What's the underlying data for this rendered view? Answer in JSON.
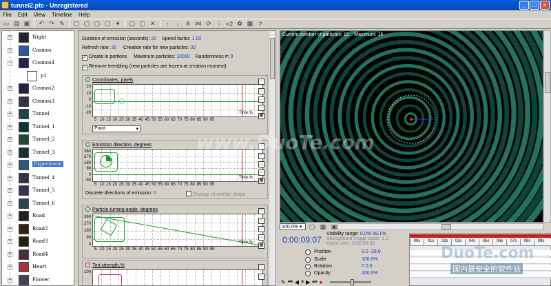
{
  "window": {
    "title": "tunnel2.ptc - Unregistered",
    "minimize": "_",
    "maximize": "□",
    "close": "×"
  },
  "menu": [
    "File",
    "Edit",
    "View",
    "Timeline",
    "Help"
  ],
  "toolbar_icons": [
    "new-icon",
    "open-icon",
    "save-icon",
    "undo-icon",
    "redo-icon",
    "cut-icon",
    "copy-icon",
    "paste-icon",
    "delete-icon",
    "up-icon",
    "down-icon",
    "emitter-icon",
    "help-icon"
  ],
  "tree": {
    "items": [
      {
        "label": "Night",
        "expander": "+"
      },
      {
        "label": "Cosmos",
        "expander": "+"
      },
      {
        "label": "Cosmos4",
        "expander": "−"
      },
      {
        "label": "p1",
        "expander": ""
      },
      {
        "label": "Cosmos2",
        "expander": "+"
      },
      {
        "label": "Cosmos3",
        "expander": "+"
      },
      {
        "label": "Tunnel",
        "expander": "+"
      },
      {
        "label": "Tunnel_1",
        "expander": "+"
      },
      {
        "label": "Tunnel_2",
        "expander": "+"
      },
      {
        "label": "Tunnel_3",
        "expander": "+"
      },
      {
        "label": "Experiment",
        "expander": "+"
      },
      {
        "label": "Tunnel_4",
        "expander": "+"
      },
      {
        "label": "Tunnel_5",
        "expander": "+"
      },
      {
        "label": "Tunnel_6",
        "expander": "+"
      },
      {
        "label": "Road",
        "expander": "+"
      },
      {
        "label": "Road2",
        "expander": "+"
      },
      {
        "label": "Road3",
        "expander": "+"
      },
      {
        "label": "Road4",
        "expander": "+"
      },
      {
        "label": "Heart",
        "expander": "+"
      },
      {
        "label": "Flower",
        "expander": "+"
      }
    ]
  },
  "params": {
    "duration_label": "Duration of emission (seconds):",
    "duration_value": "20",
    "speed_label": "Speed factor:",
    "speed_value": "1.00",
    "refresh_label": "Refresh rate:",
    "refresh_value": "30",
    "creation_label": "Creation rate for new particles:",
    "creation_value": "30",
    "portions_label": "Create in portions",
    "max_label": "Maximum particles:",
    "max_value": "10000",
    "random_label": "Randomness #:",
    "random_value": "0",
    "trembling_label": "Remove trembling (new particles are frozen at creation moment)"
  },
  "panels": {
    "coordinates": {
      "title": "Coordinates, pixels",
      "yticks": [
        "20",
        "10",
        "0",
        "-10",
        "-20"
      ],
      "dropdown": "Point"
    },
    "emission": {
      "title": "Emission direction, degrees",
      "yticks": [
        "360",
        "270",
        "180",
        "90",
        "0",
        "-90"
      ],
      "discrete_label": "Discrete directions of emission:",
      "discrete_value": "0",
      "change_label": "Change of emitter shape"
    },
    "turning": {
      "title": "Particle turning angle, degrees",
      "yticks": [
        "360",
        "270",
        "180",
        "90",
        "0"
      ]
    },
    "tint": {
      "title": "Tint strength,%",
      "yticks": [
        "100"
      ]
    },
    "xticks": [
      "5",
      "10",
      "15",
      "20",
      "25",
      "30",
      "35",
      "40",
      "45",
      "50",
      "55",
      "60",
      "65",
      "70",
      "75",
      "80",
      "85",
      "90",
      "95"
    ],
    "time_label": "Time,%"
  },
  "viewport": {
    "particles_label": "Current number of particles:",
    "particles_value": "15",
    "max_label": "Maximum:",
    "max_value": "16"
  },
  "bottom": {
    "zoom": "100.0%",
    "timecode": "0:00:09:07",
    "visibility_label": "Visibility range:",
    "visibility_value": "0.0%  89.1%",
    "bg_scale": "Background image scale: 1.0",
    "video_start": "Video start: 0:00:00:00",
    "timeline_ticks": [
      "00s",
      "01s",
      "02s",
      "03s",
      "04s",
      "05s",
      "06s",
      "07s",
      "08s",
      "09s"
    ],
    "props": [
      {
        "name": "Position",
        "value": "0.0   -28.0"
      },
      {
        "name": "Scale",
        "value": "100.0%"
      },
      {
        "name": "Rotation",
        "value": "0   0.0"
      },
      {
        "name": "Opacity",
        "value": "100.0%"
      }
    ]
  },
  "watermarks": {
    "main": "www.DuoTe.com",
    "corner": "DuoTe.com",
    "corner_sub": "国内最安全的软件站"
  }
}
